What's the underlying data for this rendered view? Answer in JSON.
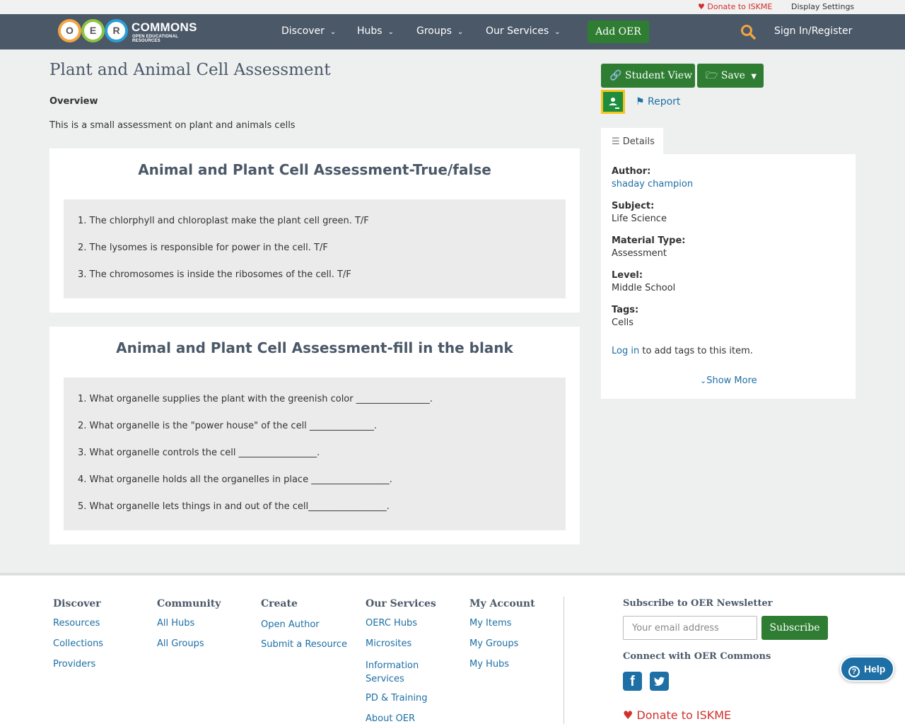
{
  "utility": {
    "donate": "Donate to ISKME",
    "display_settings": "Display Settings"
  },
  "nav": {
    "logo_letters": [
      "O",
      "E",
      "R"
    ],
    "logo_wordmark": "COMMONS",
    "logo_subtitle": "OPEN EDUCATIONAL RESOURCES",
    "items": [
      {
        "label": "Discover"
      },
      {
        "label": "Hubs"
      },
      {
        "label": "Groups"
      },
      {
        "label": "Our Services"
      }
    ],
    "add_oer": "Add OER",
    "sign_in": "Sign In/Register",
    "colors": {
      "bar": "#4b5868",
      "accent_green": "#2e7d32"
    }
  },
  "main": {
    "title": "Plant and Animal Cell Assessment",
    "overview_heading": "Overview",
    "overview_text": "This is a small assessment on plant and animals cells",
    "sections": [
      {
        "heading": "Animal and Plant Cell Assessment-True/false",
        "questions": [
          "1. The chlorphyll and chloroplast make the plant cell green. T/F",
          "2. The lysomes is responsible for power in the cell. T/F",
          "3. The chromosomes is inside the ribosomes of the cell. T/F"
        ]
      },
      {
        "heading": "Animal and Plant Cell Assessment-fill in the blank",
        "questions": [
          "1. What organelle supplies the plant with the greenish color ________________.",
          "2. What organelle is the \"power house\" of the cell ______________.",
          "3. What organelle controls the cell _________________.",
          "4. What organelle holds all the organelles in place _________________.",
          "5. What organelle lets things in and out of the cell_________________."
        ]
      }
    ]
  },
  "sidebar": {
    "student_view": "Student View",
    "save": "Save",
    "report": "Report",
    "details_tab": "Details",
    "details": [
      {
        "label": "Author:",
        "value": "shaday champion"
      },
      {
        "label": "Subject:",
        "value": "Life Science"
      },
      {
        "label": "Material Type:",
        "value": "Assessment"
      },
      {
        "label": "Level:",
        "value": "Middle School"
      },
      {
        "label": "Tags:",
        "value": "Cells"
      }
    ],
    "login_link": "Log in",
    "login_suffix": "to add tags to this item.",
    "show_more": "Show More"
  },
  "footer": {
    "columns": [
      {
        "heading": "Discover",
        "links": [
          "Resources",
          "Collections",
          "Providers"
        ]
      },
      {
        "heading": "Community",
        "links": [
          "All Hubs",
          "All Groups"
        ]
      },
      {
        "heading": "Create",
        "links": [
          "Open Author",
          "Submit a Resource"
        ]
      },
      {
        "heading": "Our Services",
        "links": [
          "OERC Hubs",
          "Microsites",
          "Information Services",
          "PD & Training",
          "About OER"
        ]
      },
      {
        "heading": "My Account",
        "links": [
          "My Items",
          "My Groups",
          "My Hubs"
        ]
      }
    ],
    "newsletter_heading": "Subscribe to OER Newsletter",
    "email_placeholder": "Your email address",
    "subscribe": "Subscribe",
    "connect_heading": "Connect with OER Commons",
    "donate": "Donate to ISKME"
  },
  "help": "Help"
}
